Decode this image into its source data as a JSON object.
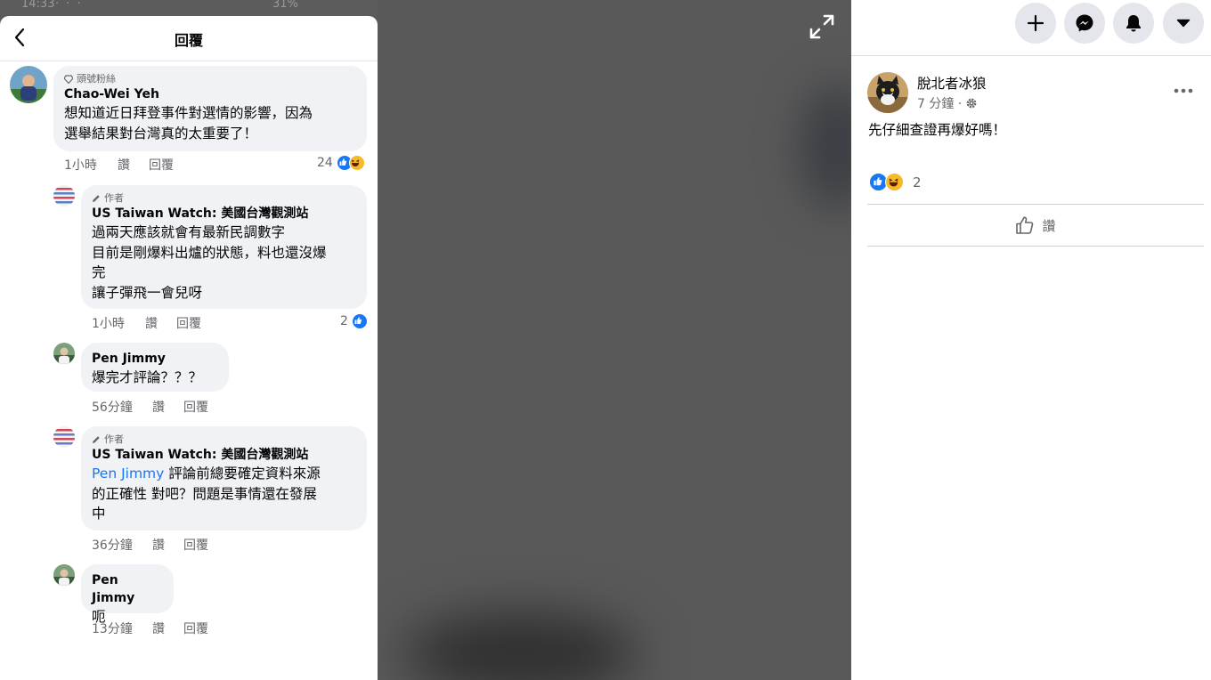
{
  "status_bar": {
    "time": "14:33",
    "dots": "· · ·",
    "right": "31%"
  },
  "replies_panel": {
    "title": "回覆",
    "comments": [
      {
        "badge": "頭號粉絲",
        "author": "Chao-Wei Yeh",
        "lines": [
          "想知道近日拜登事件對選情的影響，因為",
          "選舉結果對台灣真的太重要了！"
        ],
        "time": "1小時",
        "like": "讚",
        "reply": "回覆",
        "reaction_count": "24",
        "reactions": [
          "like",
          "haha"
        ]
      },
      {
        "badge": "作者",
        "author": "US Taiwan Watch: 美國台灣觀測站",
        "lines": [
          "過兩天應該就會有最新民調數字",
          "目前是剛爆料出爐的狀態，料也還沒爆",
          "完",
          "讓子彈飛一會兒呀"
        ],
        "time": "1小時",
        "like": "讚",
        "reply": "回覆",
        "reaction_count": "2",
        "reactions": [
          "like"
        ]
      },
      {
        "author": "Pen Jimmy",
        "lines": [
          "爆完才評論？？？"
        ],
        "time": "56分鐘",
        "like": "讚",
        "reply": "回覆"
      },
      {
        "badge": "作者",
        "author": "US Taiwan Watch: 美國台灣觀測站",
        "mention": "Pen Jimmy",
        "lines": [
          " 評論前總要確定資料來源",
          "的正確性 對吧？問題是事情還在發展",
          "中"
        ],
        "time": "36分鐘",
        "like": "讚",
        "reply": "回覆"
      },
      {
        "author": "Pen Jimmy",
        "lines": [
          "呃"
        ],
        "time": "13分鐘",
        "like": "讚",
        "reply": "回覆"
      }
    ]
  },
  "viewer": {
    "expand_icon": "expand-icon"
  },
  "post": {
    "top_buttons": [
      "plus-icon",
      "messenger-icon",
      "bell-icon",
      "caret-down-icon"
    ],
    "author": "脫北者冰狼",
    "time": "7 分鐘 ·",
    "text": "先仔細查證再爆好嗎！",
    "reaction_count": "2",
    "like_label": "讚"
  },
  "colors": {
    "accent": "#1877f2",
    "haha": "#f7b928",
    "viewer_bg": "#595959"
  }
}
